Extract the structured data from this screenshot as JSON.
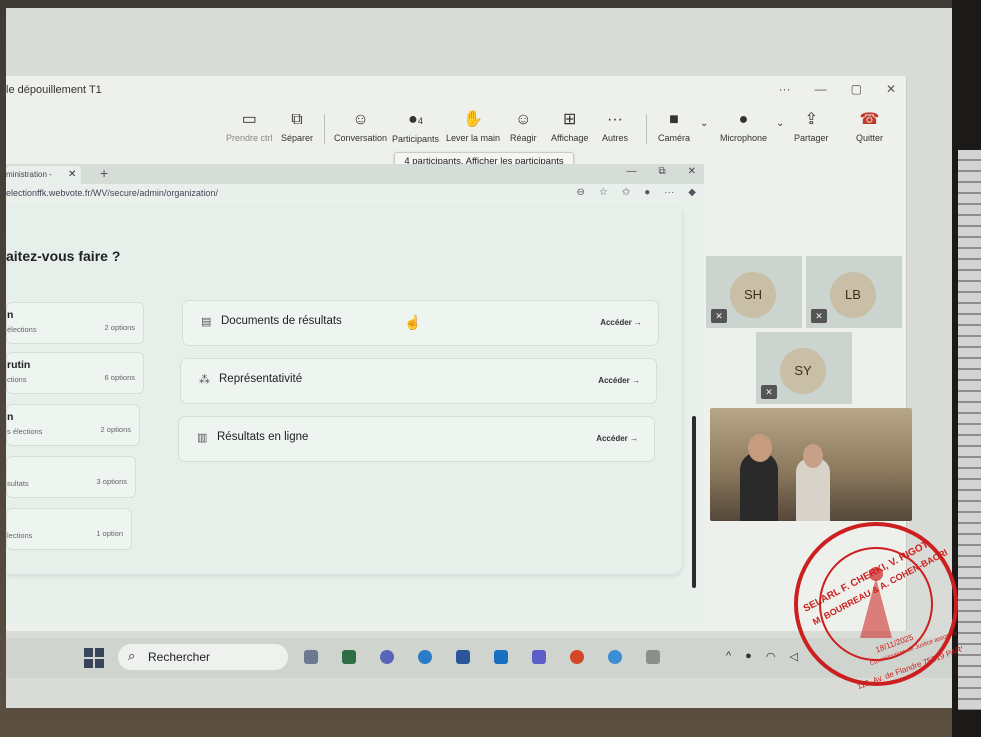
{
  "window": {
    "title": "le dépouillement T1",
    "controls": [
      "···",
      "—",
      "▢",
      "✕"
    ]
  },
  "toolbar": {
    "buttons": [
      {
        "label": "Prendre ctrl"
      },
      {
        "label": "Séparer"
      },
      {
        "label": "Conversation"
      },
      {
        "label": "Participants",
        "count": "4"
      },
      {
        "label": "Lever la main"
      },
      {
        "label": "Réagir"
      },
      {
        "label": "Affichage"
      },
      {
        "label": "Autres"
      },
      {
        "label": "Caméra"
      },
      {
        "label": "Microphone"
      },
      {
        "label": "Partager"
      },
      {
        "label": "Quitter"
      }
    ],
    "tooltip": "4 participants. Afficher les participants"
  },
  "browser": {
    "tab_label": "ministration -",
    "tab_close": "✕",
    "new_tab": "+",
    "controls": [
      "—",
      "⧉",
      "✕"
    ],
    "url": "electionffk.webvote.fr/WV/secure/admin/organization/"
  },
  "page": {
    "heading": "aitez-vous faire ?",
    "left_cards": [
      {
        "title": "n",
        "subtitle": "élections",
        "options": "2 options"
      },
      {
        "title": "rutin",
        "subtitle": "ctions",
        "options": "6 options"
      },
      {
        "title": "n",
        "subtitle": "s élections",
        "options": "2 options"
      },
      {
        "title": "",
        "subtitle": "sultats",
        "options": "3 options"
      },
      {
        "title": "",
        "subtitle": "lections",
        "options": "1 option"
      }
    ],
    "right_cards": [
      {
        "label": "Documents de résultats",
        "action": "Accéder →",
        "icon": "document-icon"
      },
      {
        "label": "Représentativité",
        "action": "Accéder →",
        "icon": "representation-icon"
      },
      {
        "label": "Résultats en ligne",
        "action": "Accéder →",
        "icon": "bar-chart-icon"
      }
    ]
  },
  "participants": [
    {
      "initials": "SH"
    },
    {
      "initials": "LB"
    },
    {
      "initials": "SY"
    }
  ],
  "taskbar": {
    "search_label": "Rechercher"
  },
  "stamp": {
    "line1": "SELARL F. CHERKI, V. RIGOT",
    "line2": "M. BOURREAU & A. COHEN-BACRI",
    "line3": "Commissaires de Justice associés",
    "line4": "119, Av. de Flandre 75019 PARIS",
    "date": "18/11/2025"
  },
  "colors": {
    "stamp_red": "#cc1f1f",
    "screen_bg": "#e9f0ec"
  }
}
